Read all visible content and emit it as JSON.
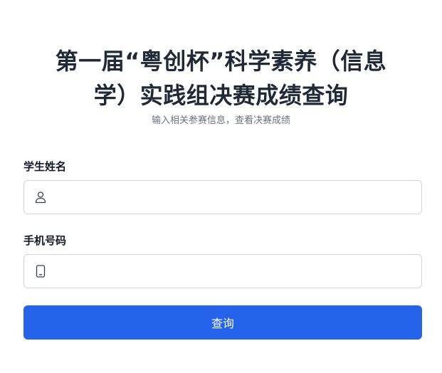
{
  "page": {
    "title": "第一届“粤创杯”科学素养（信息学）实践组决赛成绩查询",
    "subtitle": "输入相关参赛信息，查看决赛成绩"
  },
  "form": {
    "name": {
      "label": "学生姓名",
      "value": "",
      "icon": "user-icon"
    },
    "phone": {
      "label": "手机号码",
      "value": "",
      "icon": "phone-icon"
    },
    "submit_label": "查询"
  },
  "colors": {
    "primary": "#2563eb",
    "title": "#1f2937",
    "subtitle": "#6b7280",
    "border": "#d1d5db"
  }
}
